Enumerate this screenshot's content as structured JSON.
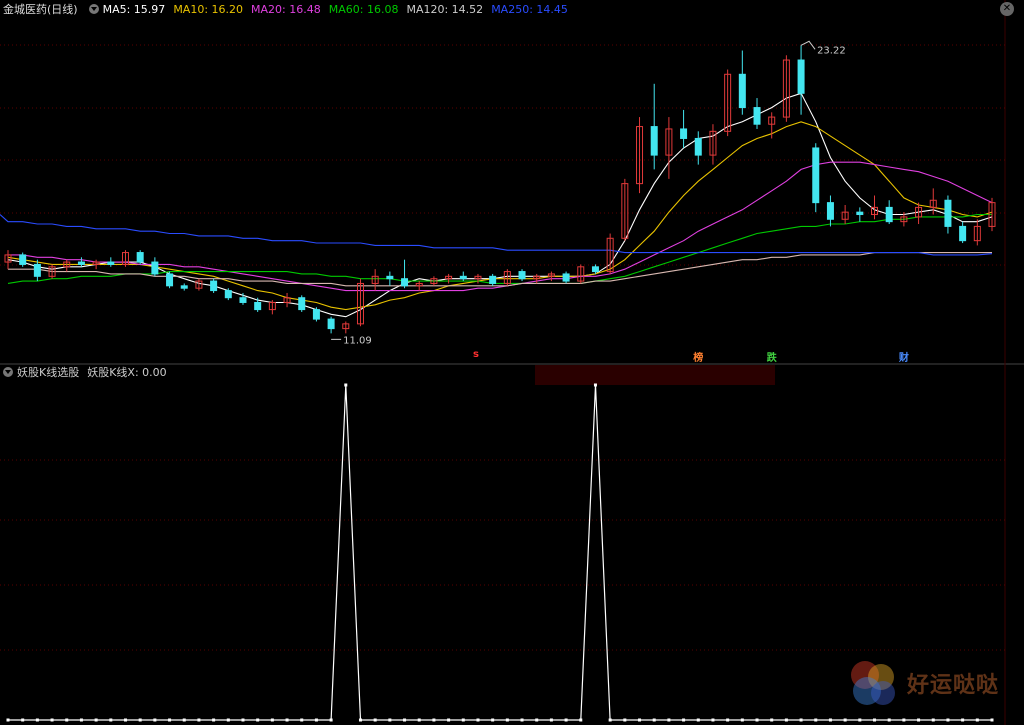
{
  "main_legend": {
    "stock_name": "金城医药(日线)",
    "ma": [
      {
        "label": "MA5: 15.97",
        "color": "#ffffff"
      },
      {
        "label": "MA10: 16.20",
        "color": "#e8c200"
      },
      {
        "label": "MA20: 16.48",
        "color": "#e040e0"
      },
      {
        "label": "MA60: 16.08",
        "color": "#00c800"
      },
      {
        "label": "MA120: 14.52",
        "color": "#cccccc"
      },
      {
        "label": "MA250: 14.45",
        "color": "#2a4cff"
      }
    ]
  },
  "indicator_legend": {
    "name": "妖股K线选股",
    "value_label": "妖股K线X: 0.00"
  },
  "annotations": {
    "high": "23.22",
    "low": "11.09"
  },
  "badges": [
    {
      "text": "s",
      "color": "#ff3030",
      "bar": 32
    },
    {
      "text": "榜",
      "color": "#ff8030",
      "bar": 47
    },
    {
      "text": "跌",
      "color": "#40d040",
      "bar": 52
    },
    {
      "text": "财",
      "color": "#4a8cff",
      "bar": 61
    }
  ],
  "watermark": "好运哒哒",
  "icons": {
    "close": "close-icon",
    "collapse": "collapse-icon"
  },
  "colors": {
    "up": "#e23a3a",
    "down": "#43e6f0",
    "grid": "#5a0000"
  },
  "chart_data": [
    {
      "type": "candlestick",
      "title": "金城医药(日线)",
      "ylim": [
        10.4,
        24.2
      ],
      "candles": [
        [
          14.1,
          14.6,
          13.8,
          14.4
        ],
        [
          14.4,
          14.5,
          13.9,
          14.0
        ],
        [
          14.0,
          14.2,
          13.3,
          13.5
        ],
        [
          13.5,
          14.0,
          13.4,
          13.9
        ],
        [
          13.9,
          14.2,
          13.7,
          14.1
        ],
        [
          14.1,
          14.3,
          13.9,
          14.0
        ],
        [
          14.0,
          14.2,
          13.8,
          14.1
        ],
        [
          14.1,
          14.3,
          13.9,
          14.0
        ],
        [
          14.0,
          14.6,
          13.9,
          14.5
        ],
        [
          14.5,
          14.6,
          14.0,
          14.1
        ],
        [
          14.1,
          14.3,
          13.5,
          13.6
        ],
        [
          13.6,
          13.7,
          13.0,
          13.1
        ],
        [
          13.1,
          13.2,
          12.9,
          13.0
        ],
        [
          13.0,
          13.4,
          12.9,
          13.3
        ],
        [
          13.3,
          13.4,
          12.8,
          12.9
        ],
        [
          12.9,
          13.0,
          12.5,
          12.6
        ],
        [
          12.6,
          12.8,
          12.3,
          12.4
        ],
        [
          12.4,
          12.6,
          12.0,
          12.1
        ],
        [
          12.1,
          12.5,
          11.9,
          12.4
        ],
        [
          12.4,
          12.8,
          12.2,
          12.6
        ],
        [
          12.6,
          12.7,
          12.0,
          12.1
        ],
        [
          12.1,
          12.2,
          11.6,
          11.7
        ],
        [
          11.7,
          11.8,
          11.1,
          11.3
        ],
        [
          11.3,
          11.6,
          11.1,
          11.5
        ],
        [
          11.5,
          13.4,
          11.4,
          13.2
        ],
        [
          13.2,
          13.8,
          12.9,
          13.5
        ],
        [
          13.5,
          13.7,
          13.1,
          13.4
        ],
        [
          13.4,
          14.2,
          13.0,
          13.1
        ],
        [
          13.1,
          13.3,
          12.9,
          13.2
        ],
        [
          13.2,
          13.5,
          13.1,
          13.4
        ],
        [
          13.4,
          13.6,
          13.2,
          13.5
        ],
        [
          13.5,
          13.7,
          13.3,
          13.4
        ],
        [
          13.4,
          13.6,
          13.2,
          13.5
        ],
        [
          13.5,
          13.6,
          13.1,
          13.2
        ],
        [
          13.2,
          13.8,
          13.1,
          13.7
        ],
        [
          13.7,
          13.8,
          13.3,
          13.4
        ],
        [
          13.4,
          13.6,
          13.2,
          13.5
        ],
        [
          13.5,
          13.7,
          13.3,
          13.6
        ],
        [
          13.6,
          13.7,
          13.2,
          13.3
        ],
        [
          13.3,
          14.0,
          13.2,
          13.9
        ],
        [
          13.9,
          14.0,
          13.6,
          13.7
        ],
        [
          13.7,
          15.3,
          13.6,
          15.1
        ],
        [
          15.1,
          17.6,
          15.0,
          17.4
        ],
        [
          17.4,
          20.2,
          17.0,
          19.8
        ],
        [
          19.8,
          21.6,
          18.0,
          18.6
        ],
        [
          18.6,
          20.2,
          17.6,
          19.7
        ],
        [
          19.7,
          20.5,
          18.9,
          19.3
        ],
        [
          19.3,
          19.6,
          18.2,
          18.6
        ],
        [
          18.6,
          19.9,
          18.2,
          19.6
        ],
        [
          19.6,
          22.2,
          19.4,
          22.0
        ],
        [
          22.0,
          23.0,
          20.3,
          20.6
        ],
        [
          20.6,
          21.0,
          19.7,
          19.9
        ],
        [
          19.9,
          20.4,
          19.3,
          20.2
        ],
        [
          20.2,
          22.8,
          20.0,
          22.6
        ],
        [
          22.6,
          23.22,
          20.3,
          21.2
        ],
        [
          18.9,
          19.1,
          16.2,
          16.6
        ],
        [
          16.6,
          16.9,
          15.6,
          15.9
        ],
        [
          15.9,
          16.5,
          15.7,
          16.2
        ],
        [
          16.2,
          16.4,
          15.8,
          16.1
        ],
        [
          16.1,
          16.9,
          15.9,
          16.4
        ],
        [
          16.4,
          16.7,
          15.7,
          15.8
        ],
        [
          15.8,
          16.2,
          15.6,
          16.0
        ],
        [
          16.0,
          16.6,
          15.7,
          16.4
        ],
        [
          16.4,
          17.2,
          16.1,
          16.7
        ],
        [
          16.7,
          16.9,
          15.3,
          15.6
        ],
        [
          15.6,
          15.8,
          14.9,
          15.0
        ],
        [
          15.0,
          15.9,
          14.8,
          15.6
        ],
        [
          15.6,
          16.8,
          15.4,
          16.6
        ]
      ],
      "ma_lines": {
        "MA5": [
          14.2,
          14.1,
          13.9,
          13.8,
          13.9,
          13.9,
          14.0,
          14.1,
          14.1,
          14.1,
          13.9,
          13.6,
          13.4,
          13.2,
          13.1,
          12.9,
          12.7,
          12.5,
          12.4,
          12.4,
          12.3,
          12.1,
          11.9,
          11.8,
          12.1,
          12.5,
          12.9,
          13.2,
          13.4,
          13.3,
          13.4,
          13.4,
          13.4,
          13.4,
          13.5,
          13.5,
          13.5,
          13.5,
          13.5,
          13.5,
          13.6,
          14.0,
          15.0,
          16.3,
          17.4,
          18.3,
          18.9,
          19.3,
          19.4,
          19.8,
          20.0,
          20.3,
          20.6,
          21.0,
          21.2,
          20.0,
          18.5,
          17.5,
          16.8,
          16.3,
          16.1,
          16.1,
          16.2,
          16.3,
          16.1,
          15.8,
          15.8,
          16.0
        ],
        "MA10": [
          14.3,
          14.2,
          14.1,
          14.0,
          14.0,
          14.0,
          14.0,
          14.0,
          14.0,
          14.0,
          13.9,
          13.8,
          13.7,
          13.6,
          13.5,
          13.3,
          13.1,
          12.9,
          12.8,
          12.6,
          12.5,
          12.4,
          12.2,
          12.1,
          12.2,
          12.3,
          12.5,
          12.6,
          12.8,
          12.9,
          13.1,
          13.2,
          13.3,
          13.4,
          13.4,
          13.4,
          13.4,
          13.5,
          13.5,
          13.5,
          13.6,
          13.8,
          14.2,
          14.8,
          15.4,
          16.2,
          16.9,
          17.5,
          18.0,
          18.5,
          19.0,
          19.3,
          19.5,
          19.8,
          20.0,
          19.8,
          19.4,
          19.0,
          18.6,
          18.2,
          17.5,
          16.8,
          16.5,
          16.4,
          16.3,
          16.1,
          16.0,
          16.2
        ],
        "MA20": [
          14.4,
          14.4,
          14.3,
          14.3,
          14.2,
          14.2,
          14.1,
          14.1,
          14.1,
          14.0,
          14.0,
          14.0,
          13.9,
          13.9,
          13.8,
          13.7,
          13.6,
          13.5,
          13.4,
          13.3,
          13.2,
          13.1,
          13.0,
          12.9,
          12.9,
          12.9,
          12.9,
          12.9,
          12.9,
          12.9,
          12.9,
          12.9,
          13.0,
          13.0,
          13.1,
          13.2,
          13.3,
          13.4,
          13.4,
          13.5,
          13.5,
          13.6,
          13.8,
          14.1,
          14.4,
          14.7,
          15.0,
          15.4,
          15.7,
          16.0,
          16.3,
          16.7,
          17.1,
          17.5,
          18.0,
          18.2,
          18.3,
          18.3,
          18.3,
          18.2,
          18.1,
          18.0,
          17.9,
          17.7,
          17.5,
          17.2,
          16.9,
          16.6
        ],
        "MA60": [
          13.2,
          13.3,
          13.3,
          13.4,
          13.4,
          13.5,
          13.5,
          13.5,
          13.6,
          13.6,
          13.6,
          13.7,
          13.7,
          13.7,
          13.7,
          13.7,
          13.7,
          13.7,
          13.7,
          13.7,
          13.6,
          13.6,
          13.5,
          13.5,
          13.4,
          13.4,
          13.4,
          13.3,
          13.3,
          13.3,
          13.3,
          13.3,
          13.3,
          13.2,
          13.2,
          13.2,
          13.2,
          13.2,
          13.2,
          13.2,
          13.3,
          13.4,
          13.5,
          13.7,
          13.9,
          14.1,
          14.3,
          14.5,
          14.7,
          14.9,
          15.1,
          15.3,
          15.4,
          15.5,
          15.6,
          15.6,
          15.7,
          15.7,
          15.8,
          15.8,
          15.9,
          15.9,
          16.0,
          16.0,
          16.0,
          16.0,
          16.1,
          16.1
        ],
        "MA120": [
          13.8,
          13.8,
          13.8,
          13.7,
          13.7,
          13.7,
          13.7,
          13.6,
          13.6,
          13.6,
          13.5,
          13.5,
          13.5,
          13.4,
          13.4,
          13.4,
          13.3,
          13.3,
          13.3,
          13.2,
          13.2,
          13.2,
          13.2,
          13.1,
          13.1,
          13.1,
          13.1,
          13.1,
          13.1,
          13.1,
          13.1,
          13.1,
          13.1,
          13.1,
          13.1,
          13.2,
          13.2,
          13.2,
          13.2,
          13.2,
          13.3,
          13.3,
          13.4,
          13.5,
          13.6,
          13.7,
          13.8,
          13.9,
          14.0,
          14.1,
          14.2,
          14.2,
          14.3,
          14.3,
          14.4,
          14.4,
          14.4,
          14.4,
          14.4,
          14.5,
          14.5,
          14.5,
          14.5,
          14.5,
          14.5,
          14.5,
          14.5,
          14.5
        ],
        "MA250": [
          15.8,
          15.8,
          15.7,
          15.7,
          15.6,
          15.6,
          15.5,
          15.5,
          15.5,
          15.4,
          15.4,
          15.3,
          15.3,
          15.2,
          15.2,
          15.2,
          15.1,
          15.1,
          15.0,
          15.0,
          15.0,
          14.9,
          14.9,
          14.9,
          14.9,
          14.8,
          14.8,
          14.8,
          14.8,
          14.7,
          14.7,
          14.7,
          14.7,
          14.7,
          14.6,
          14.6,
          14.6,
          14.6,
          14.6,
          14.6,
          14.6,
          14.6,
          14.5,
          14.5,
          14.5,
          14.5,
          14.5,
          14.5,
          14.5,
          14.5,
          14.5,
          14.5,
          14.5,
          14.5,
          14.5,
          14.5,
          14.5,
          14.5,
          14.5,
          14.5,
          14.5,
          14.5,
          14.5,
          14.4,
          14.4,
          14.4,
          14.4,
          14.45
        ]
      }
    },
    {
      "type": "line",
      "title": "妖股K线选股",
      "series": [
        {
          "name": "妖股K线X",
          "values": [
            0,
            0,
            0,
            0,
            0,
            0,
            0,
            0,
            0,
            0,
            0,
            0,
            0,
            0,
            0,
            0,
            0,
            0,
            0,
            0,
            0,
            0,
            0,
            1,
            0,
            0,
            0,
            0,
            0,
            0,
            0,
            0,
            0,
            0,
            0,
            0,
            0,
            0,
            0,
            0,
            1,
            0,
            0,
            0,
            0,
            0,
            0,
            0,
            0,
            0,
            0,
            0,
            0,
            0,
            0,
            0,
            0,
            0,
            0,
            0,
            0,
            0,
            0,
            0,
            0,
            0,
            0,
            0
          ]
        }
      ],
      "ylim": [
        0,
        1
      ]
    }
  ]
}
